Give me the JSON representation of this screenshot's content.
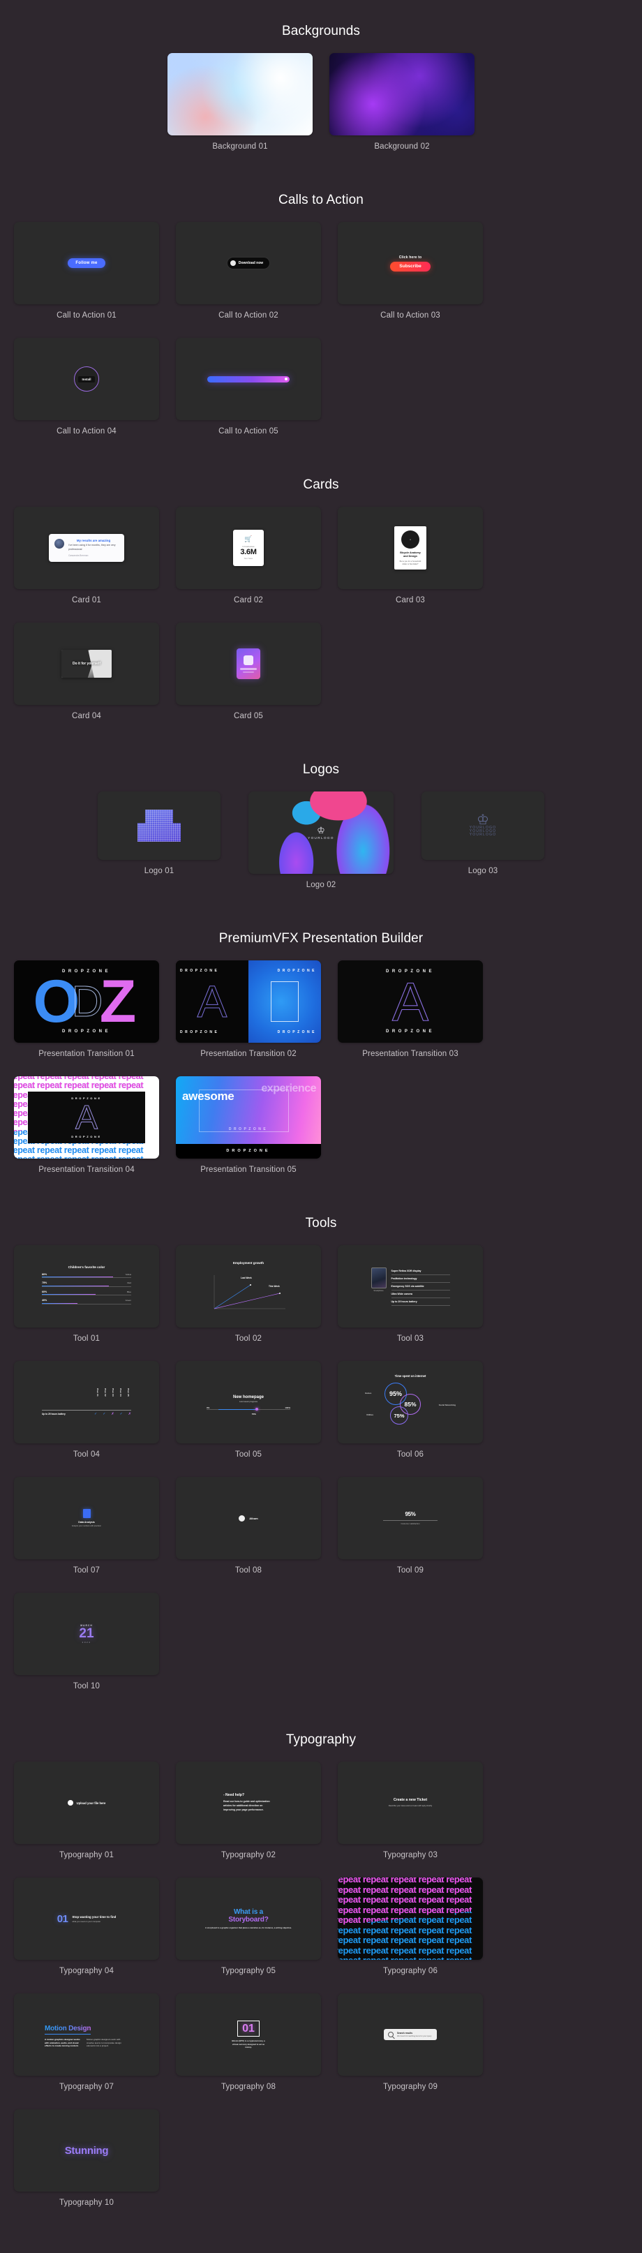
{
  "sections": [
    {
      "title": "Backgrounds",
      "items": [
        {
          "caption": "Background 01"
        },
        {
          "caption": "Background 02"
        }
      ]
    },
    {
      "title": "Calls to Action",
      "items": [
        {
          "caption": "Call to Action 01",
          "button_label": "Follow me"
        },
        {
          "caption": "Call to Action 02",
          "button_label": "Download now"
        },
        {
          "caption": "Call to Action 03",
          "pre_label": "Click here to",
          "button_label": "Subscribe"
        },
        {
          "caption": "Call to Action 04",
          "button_label": "Install"
        },
        {
          "caption": "Call to Action 05"
        }
      ]
    },
    {
      "title": "Cards",
      "items": [
        {
          "caption": "Card 01",
          "title": "My results are amazing",
          "body": "I've been using it for months, they are very professional",
          "byline": "Cassandra Brennan"
        },
        {
          "caption": "Card 02",
          "label": "In businesses",
          "value": "3.6M",
          "sub": "New Sales"
        },
        {
          "caption": "Card 03",
          "title": "Bicycle Anatomy and Design",
          "body": "But a you for a household dollar or flat dollar?"
        },
        {
          "caption": "Card 04",
          "overlay": "Do it for yourself"
        },
        {
          "caption": "Card 05"
        }
      ]
    },
    {
      "title": "Logos",
      "items": [
        {
          "caption": "Logo 01"
        },
        {
          "caption": "Logo 02",
          "logo_text": "YOURLOGO"
        },
        {
          "caption": "Logo 03",
          "logo_text": "YOURLOGO"
        }
      ]
    },
    {
      "title": "PremiumVFX Presentation Builder",
      "items": [
        {
          "caption": "Presentation Transition 01",
          "brand": "DROPZONE"
        },
        {
          "caption": "Presentation Transition 02",
          "brand": "DROPZONE"
        },
        {
          "caption": "Presentation Transition 03",
          "brand": "DROPZONE"
        },
        {
          "caption": "Presentation Transition 04",
          "brand": "DROPZONE",
          "repeat_word": "repeat"
        },
        {
          "caption": "Presentation Transition 05",
          "brand": "DROPZONE",
          "word1": "awesome",
          "word2": "experience"
        }
      ]
    },
    {
      "title": "Tools",
      "items": [
        {
          "caption": "Tool 01"
        },
        {
          "caption": "Tool 02"
        },
        {
          "caption": "Tool 03"
        },
        {
          "caption": "Tool 04"
        },
        {
          "caption": "Tool 05"
        },
        {
          "caption": "Tool 06"
        },
        {
          "caption": "Tool 07"
        },
        {
          "caption": "Tool 08"
        },
        {
          "caption": "Tool 09"
        },
        {
          "caption": "Tool 10"
        }
      ]
    },
    {
      "title": "Typography",
      "items": [
        {
          "caption": "Typography 01"
        },
        {
          "caption": "Typography 02"
        },
        {
          "caption": "Typography 03"
        },
        {
          "caption": "Typography 04"
        },
        {
          "caption": "Typography 05"
        },
        {
          "caption": "Typography 06"
        },
        {
          "caption": "Typography 07"
        },
        {
          "caption": "Typography 08"
        },
        {
          "caption": "Typography 09"
        },
        {
          "caption": "Typography 10"
        }
      ]
    }
  ],
  "tools": {
    "tool01": {
      "title": "Children's favorite color",
      "rows": [
        {
          "pct": "80%",
          "name": "Yellow"
        },
        {
          "pct": "75%",
          "name": "Red"
        },
        {
          "pct": "60%",
          "name": "Blue"
        },
        {
          "pct": "40%",
          "name": "Green"
        }
      ]
    },
    "tool02": {
      "title": "Employment growth",
      "series": [
        {
          "name": "Last Week",
          "color": "#3b8cf5"
        },
        {
          "name": "This Week",
          "color": "#b06cf0"
        }
      ]
    },
    "tool03": {
      "device": "Smartphone",
      "features": [
        "Super Retina XDR display",
        "ProMotion technology",
        "Emergency SOS via satellite",
        "Ultra Wide camera",
        "Up to 29 hours battery"
      ]
    },
    "tool04": {
      "columns": [
        "Plan 01",
        "Plan 02",
        "Plan 03",
        "Plan 04",
        "Plan 05"
      ],
      "row_label": "Up to 29 hours battery",
      "marks": [
        "check",
        "check",
        "cross",
        "check",
        "cross"
      ]
    },
    "tool05": {
      "title": "New homepage",
      "subtitle": "Last week progress",
      "start": "0%",
      "end": "100%",
      "current": "70%"
    },
    "tool06": {
      "title": "Time spent on internet",
      "bubbles": [
        {
          "value": "95%",
          "label": "Games"
        },
        {
          "value": "85%",
          "label": "Social Networking"
        },
        {
          "value": "75%",
          "label": "Utilities"
        }
      ]
    },
    "tool07": {
      "title": "Data Analysis",
      "body": "Analyze your numbers with precision"
    },
    "tool08": {
      "label": "Album"
    },
    "tool09": {
      "value": "95%",
      "label": "Customer satisfaction"
    },
    "tool10": {
      "month": "MARCH",
      "day": "21",
      "year": "2024"
    }
  },
  "typography": {
    "ty01": {
      "text": "Upload your file here"
    },
    "ty02": {
      "title": "- Need help?",
      "body": "Read our how-to guide and optimization articles for additional direction on improving your page performance."
    },
    "ty03": {
      "title": "Create a new Ticket",
      "body": "Describe your issue and our team will reply shortly"
    },
    "ty04": {
      "number": "01",
      "title": "Stop wasting your time to find",
      "body": "what you need on your computer"
    },
    "ty05": {
      "line1": "What is a",
      "line2": "Storyboard?",
      "body": "A storyboard is a graphic organizer that plans a narrative as, for instance, a writing objective."
    },
    "ty06": {
      "repeat_word": "repeat"
    },
    "ty07": {
      "title": "Motion Design",
      "col1": "A motion graphics designer works with animation, audio, and visual effects to create moving content.",
      "col2": "Motion graphic designers work with creative teams to incorporate design elements into a project."
    },
    "ty08": {
      "number": "01",
      "body": "Bitcoin (BTC) is a cryptocurrency, a virtual currency designed to act as money."
    },
    "ty09": {
      "title": "Search results",
      "body": "We found 24 matching items for your query"
    },
    "ty10": {
      "text": "Stunning"
    }
  }
}
